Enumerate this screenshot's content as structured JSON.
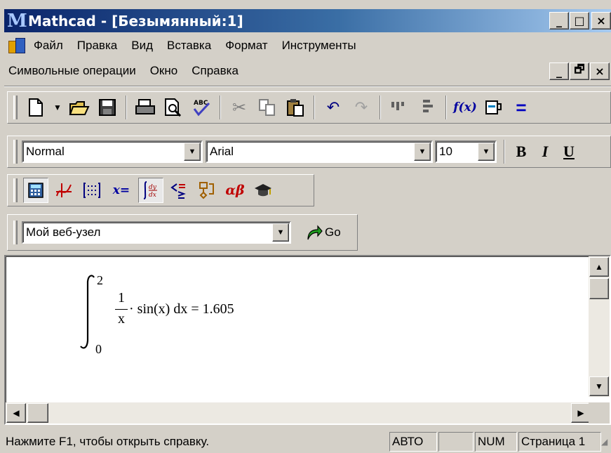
{
  "window": {
    "title": "Mathcad - [Безымянный:1]",
    "minimize": "_",
    "maximize": "□",
    "close": "×",
    "restore": "🗗"
  },
  "menu": {
    "row1": [
      "Файл",
      "Правка",
      "Вид",
      "Вставка",
      "Формат",
      "Инструменты"
    ],
    "row2": [
      "Символьные операции",
      "Окно",
      "Справка"
    ]
  },
  "toolbar_format": {
    "style": "Normal",
    "font": "Arial",
    "size": "10",
    "bold": "B",
    "italic": "I",
    "underline": "U"
  },
  "toolbar_math": {
    "evaluation": "x="
  },
  "toolbar_web": {
    "address": "Мой веб-узел",
    "go": "Go"
  },
  "worksheet": {
    "upper_limit": "2",
    "lower_limit": "0",
    "numerator": "1",
    "denominator": "x",
    "expression": "· sin(x) dx = 1.605"
  },
  "status": {
    "help_text": "Нажмите F1, чтобы открыть справку.",
    "mode": "АВТО",
    "caps": "",
    "num": "NUM",
    "page": "Страница 1"
  }
}
